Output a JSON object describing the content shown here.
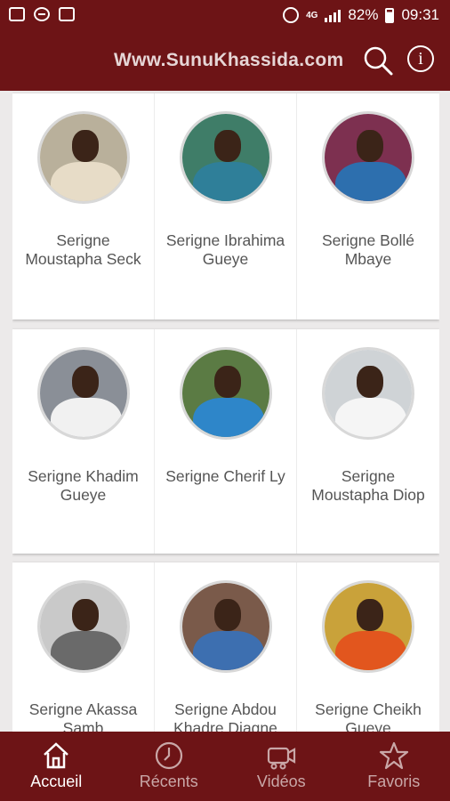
{
  "status": {
    "network": "4G",
    "battery": "82%",
    "time": "09:31",
    "left_icons": [
      "image-icon",
      "block-icon",
      "mail-icon"
    ]
  },
  "appbar": {
    "title": "Www.SunuKhassida.com",
    "search_icon": "search-icon",
    "info_icon": "info-icon",
    "info_glyph": "i"
  },
  "grid": {
    "rows": [
      [
        {
          "name": "Serigne Moustapha Seck",
          "bg": "#b9b09b",
          "body": "#e7dcc7"
        },
        {
          "name": "Serigne Ibrahima Gueye",
          "bg": "#3f7d68",
          "body": "#2f7f99"
        },
        {
          "name": "Serigne Bollé Mbaye",
          "bg": "#7d3050",
          "body": "#2d6fae"
        }
      ],
      [
        {
          "name": "Serigne Khadim Gueye",
          "bg": "#8a8f97",
          "body": "#f1f1f1"
        },
        {
          "name": "Serigne Cherif Ly",
          "bg": "#5b7b44",
          "body": "#2e86c9"
        },
        {
          "name": "Serigne Moustapha Diop",
          "bg": "#cfd3d6",
          "body": "#f5f5f5"
        }
      ],
      [
        {
          "name": "Serigne Akassa Samb",
          "bg": "#c9c9c9",
          "body": "#6a6a6a"
        },
        {
          "name": "Serigne Abdou Khadre Diagne",
          "bg": "#7a5a4a",
          "body": "#3d6fb0"
        },
        {
          "name": "Serigne Cheikh Gueye",
          "bg": "#c9a23a",
          "body": "#e2561e"
        }
      ]
    ]
  },
  "nav": {
    "items": [
      {
        "label": "Accueil",
        "icon": "home-icon",
        "active": true
      },
      {
        "label": "Récents",
        "icon": "clock-icon",
        "active": false
      },
      {
        "label": "Vidéos",
        "icon": "video-icon",
        "active": false
      },
      {
        "label": "Favoris",
        "icon": "star-icon",
        "active": false
      }
    ]
  },
  "colors": {
    "primary": "#6d1416",
    "background": "#eceaea",
    "card": "#ffffff"
  }
}
